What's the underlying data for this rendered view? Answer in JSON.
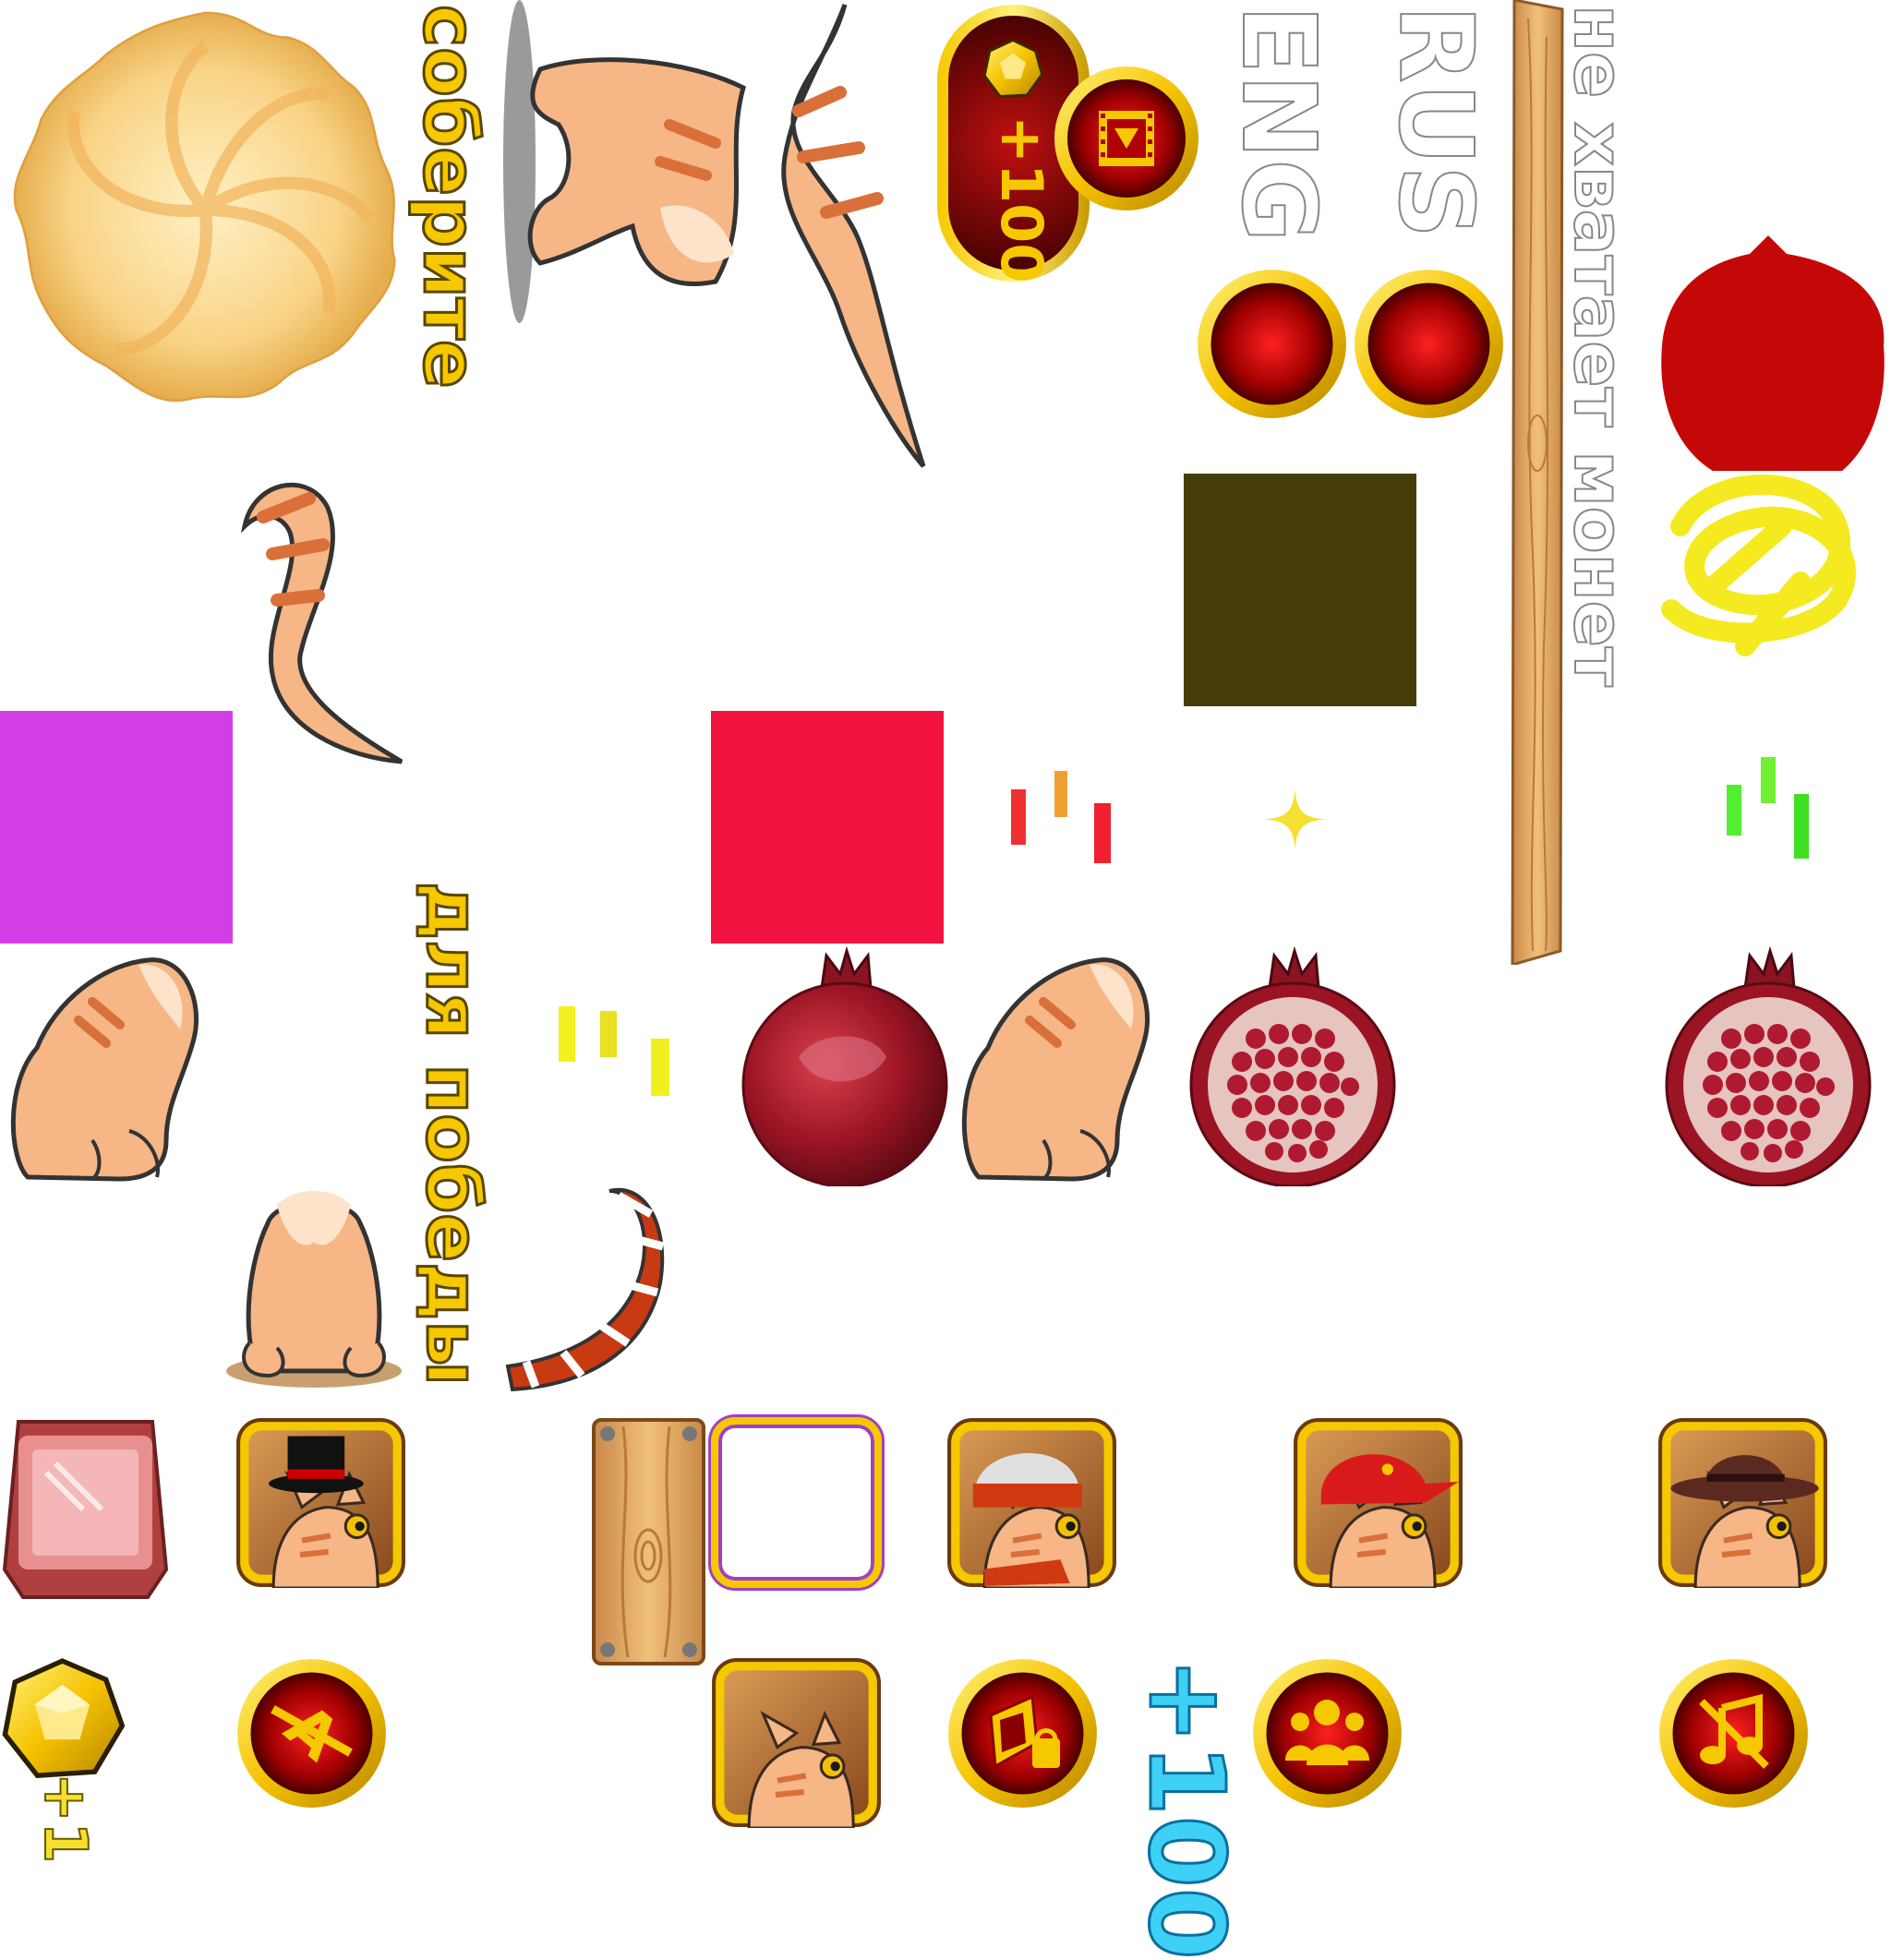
{
  "texts": {
    "collect": "соберите",
    "for_win": "для победы",
    "rus": "RUS",
    "eng": "ENG",
    "not_enough": "не хватает монет",
    "plus100_gold": "+100",
    "plus100_blue": "+100",
    "plus1": "+1"
  },
  "colors": {
    "gold": "#f5c800",
    "deep_red": "#8a0000",
    "cat_fur": "#f6b686",
    "cat_stripe": "#d9703a",
    "pomegranate": "#9a1a2a",
    "magenta_swatch": "#d23ee6",
    "pink_swatch": "#f21240",
    "olive_swatch": "#463c08",
    "blue_text": "#3fd0f5",
    "red_blob": "#c40808"
  },
  "icons": [
    "cookie-icon",
    "cat-body-icon",
    "cat-tail-icon",
    "coin-icon",
    "video-reward-icon",
    "red-ball-icon",
    "wood-plank-icon",
    "pomegranate-icon",
    "cut-pomegranate-icon",
    "sparkle-icon",
    "speed-lines-icon",
    "gem-frame-icon",
    "top-hat-cat-avatar-icon",
    "beanie-cat-avatar-icon",
    "cap-cat-avatar-icon",
    "fedora-cat-avatar-icon",
    "plain-cat-avatar-icon",
    "empty-frame-icon",
    "translate-icon",
    "shop-icon",
    "friends-icon",
    "music-off-icon",
    "scarf-tail-icon"
  ]
}
